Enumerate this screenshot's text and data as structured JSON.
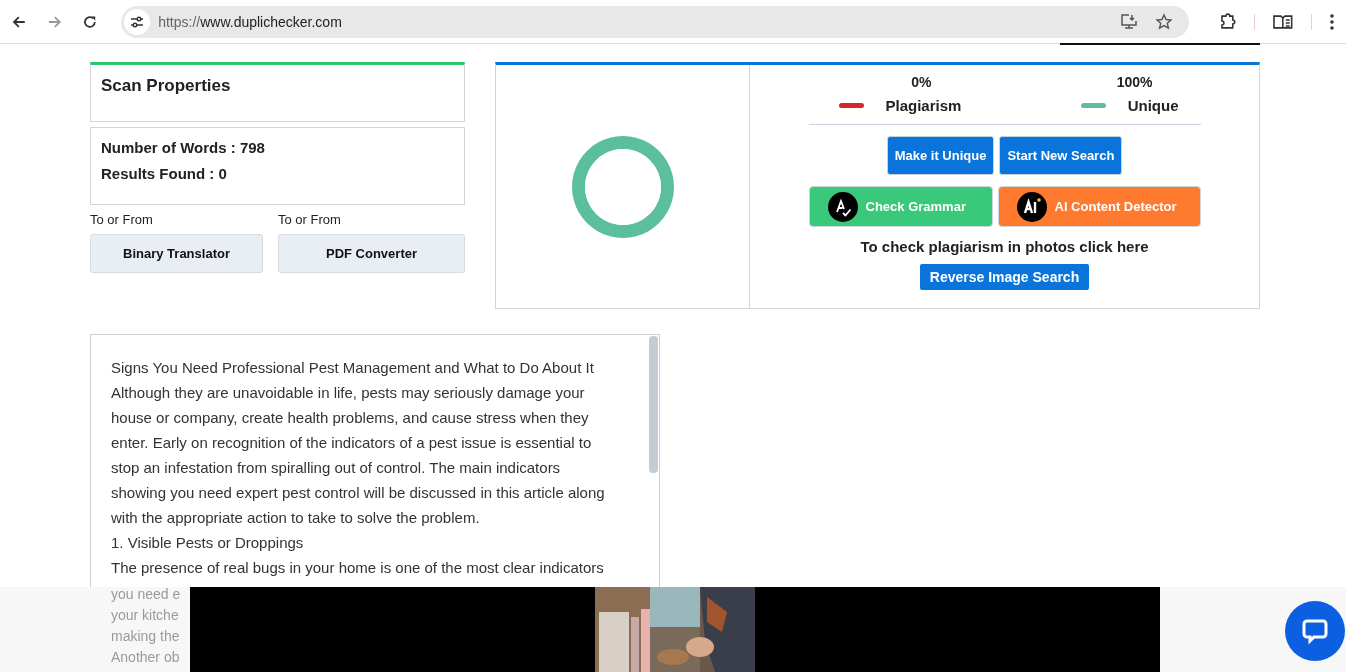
{
  "browser": {
    "url_scheme": "https://",
    "url_host": "www.duplichecker.com"
  },
  "scan": {
    "title": "Scan Properties",
    "words_label": "Number of Words : ",
    "words": "798",
    "results_label": "Results Found : ",
    "results": "0"
  },
  "tools": [
    {
      "caption": "To or From",
      "button": "Binary Translator"
    },
    {
      "caption": "To or From",
      "button": "PDF Converter"
    }
  ],
  "result": {
    "chart_data": {
      "type": "donut",
      "categories": [
        "Plagiarism",
        "Unique"
      ],
      "values": [
        0,
        100
      ]
    },
    "legend": [
      {
        "percent": "0%",
        "color": "#d9262b"
      },
      {
        "percent": "100%",
        "color": "#5bbf9d"
      }
    ],
    "actions": [
      {
        "label": "Make it Unique",
        "kind": "plain"
      },
      {
        "label": "Start New Search",
        "kind": "plain"
      }
    ],
    "tools": [
      {
        "label": "Check Grammar",
        "kind": "grammar"
      },
      {
        "label": "AI Content Detector",
        "kind": "ai"
      }
    ],
    "photo_hint": "To check plagiarism in photos click here",
    "reverse_button": "Reverse Image Search"
  },
  "text": {
    "lines": [
      "Signs You Need Professional Pest Management and What to Do About It",
      "Although they are unavoidable in life, pests may seriously damage your house or company, create health problems, and cause stress when they enter. Early on recognition of the indicators of a pest issue is essential to stop an infestation from spiralling out of control. The main indicators showing you need expert pest control will be discussed in this article along with the appropriate action to take to solve the problem.",
      "1. Visible Pests or Droppings",
      "The presence of real bugs in your home is one of the most clear indicators"
    ],
    "faded": [
      "you need e",
      "your kitche",
      "making the",
      "Another ob"
    ]
  }
}
